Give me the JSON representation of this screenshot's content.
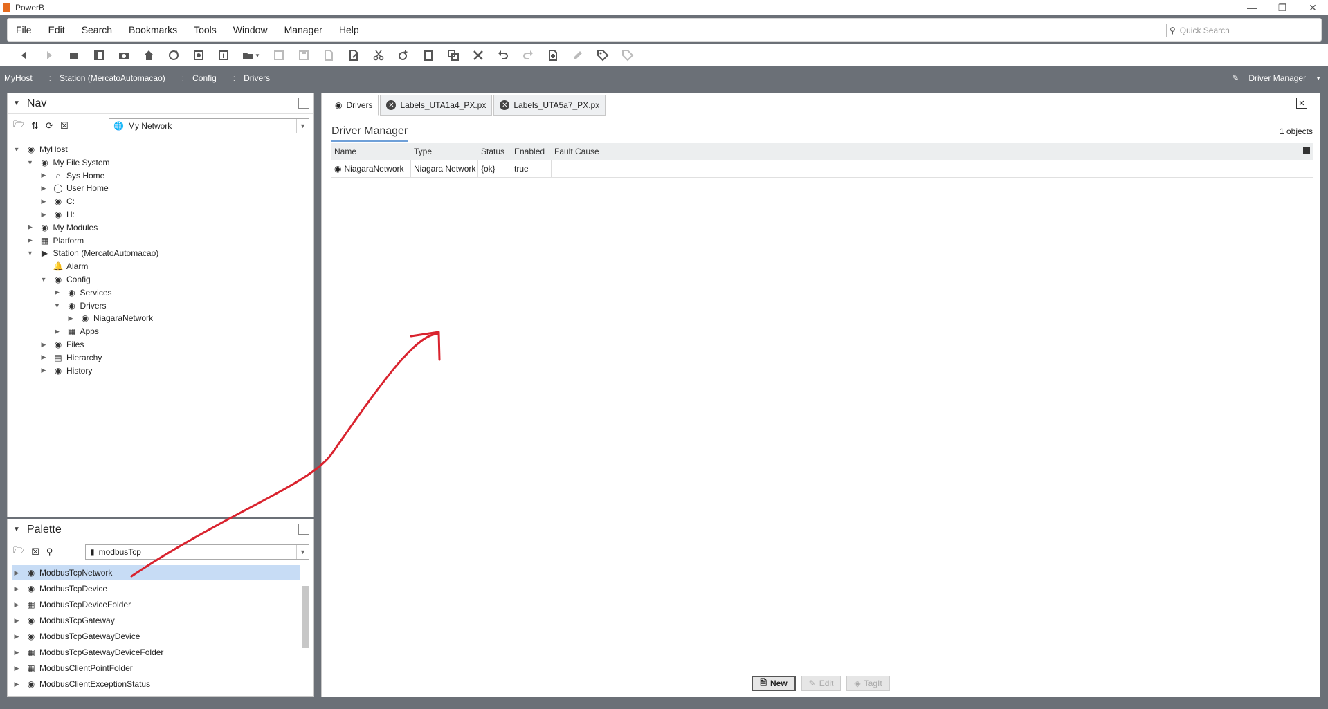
{
  "window": {
    "title": "PowerB",
    "controls": [
      "minimize-icon",
      "restore-icon",
      "close-icon"
    ]
  },
  "menu": {
    "items": [
      "File",
      "Edit",
      "Search",
      "Bookmarks",
      "Tools",
      "Window",
      "Manager",
      "Help"
    ],
    "quick_search_placeholder": "Quick Search"
  },
  "breadcrumb": {
    "items": [
      "MyHost",
      "Station (MercatoAutomacao)",
      "Config",
      "Drivers"
    ],
    "view": "Driver Manager"
  },
  "nav": {
    "title": "Nav",
    "selector": "My Network",
    "tree": [
      {
        "label": "MyHost",
        "level": 0,
        "state": "open"
      },
      {
        "label": "My File System",
        "level": 1,
        "state": "open"
      },
      {
        "label": "Sys Home",
        "level": 2,
        "state": "closed"
      },
      {
        "label": "User Home",
        "level": 2,
        "state": "closed"
      },
      {
        "label": "C:",
        "level": 2,
        "state": "closed"
      },
      {
        "label": "H:",
        "level": 2,
        "state": "closed"
      },
      {
        "label": "My Modules",
        "level": 1,
        "state": "closed"
      },
      {
        "label": "Platform",
        "level": 1,
        "state": "closed"
      },
      {
        "label": "Station (MercatoAutomacao)",
        "level": 1,
        "state": "open"
      },
      {
        "label": "Alarm",
        "level": 2,
        "state": "none"
      },
      {
        "label": "Config",
        "level": 2,
        "state": "open"
      },
      {
        "label": "Services",
        "level": 3,
        "state": "closed"
      },
      {
        "label": "Drivers",
        "level": 3,
        "state": "open"
      },
      {
        "label": "NiagaraNetwork",
        "level": 4,
        "state": "closed"
      },
      {
        "label": "Apps",
        "level": 3,
        "state": "closed"
      },
      {
        "label": "Files",
        "level": 2,
        "state": "closed"
      },
      {
        "label": "Hierarchy",
        "level": 2,
        "state": "closed"
      },
      {
        "label": "History",
        "level": 2,
        "state": "closed"
      }
    ]
  },
  "palette": {
    "title": "Palette",
    "selector": "modbusTcp",
    "items": [
      "ModbusTcpNetwork",
      "ModbusTcpDevice",
      "ModbusTcpDeviceFolder",
      "ModbusTcpGateway",
      "ModbusTcpGatewayDevice",
      "ModbusTcpGatewayDeviceFolder",
      "ModbusClientPointFolder",
      "ModbusClientExceptionStatus"
    ],
    "selected": 0
  },
  "tabs": [
    {
      "label": "Drivers",
      "active": true
    },
    {
      "label": "Labels_UTA1a4_PX.px",
      "active": false
    },
    {
      "label": "Labels_UTA5a7_PX.px",
      "active": false
    }
  ],
  "manager": {
    "title": "Driver Manager",
    "count": "1 objects",
    "columns": [
      "Name",
      "Type",
      "Status",
      "Enabled",
      "Fault Cause"
    ],
    "rows": [
      {
        "name": "NiagaraNetwork",
        "type": "Niagara Network",
        "status": "{ok}",
        "enabled": "true",
        "fault": ""
      }
    ],
    "buttons": {
      "new": "New",
      "edit": "Edit",
      "tagit": "TagIt"
    }
  },
  "annotation": {
    "color": "#d9232e"
  }
}
